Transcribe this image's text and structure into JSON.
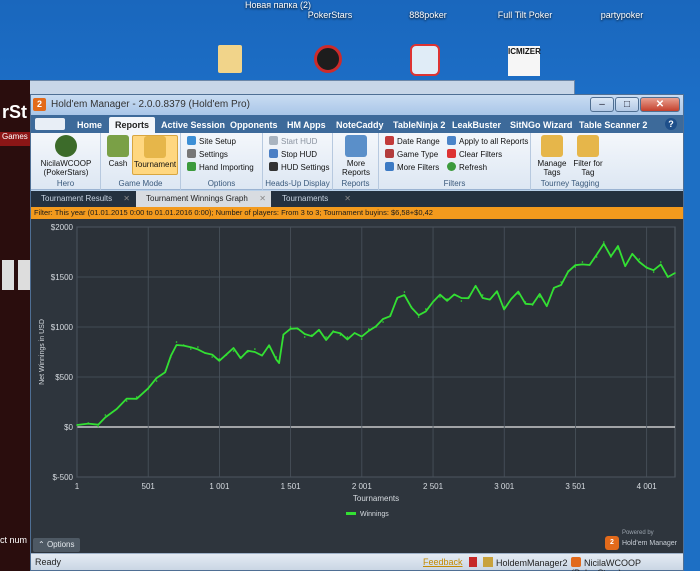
{
  "desktop": {
    "icons": [
      {
        "label": "Новая папка (2)",
        "icon": "folder-icon"
      },
      {
        "label": "PokerStars",
        "icon": "pokerstars-icon"
      },
      {
        "label": "888poker",
        "icon": "888poker-icon"
      },
      {
        "label": "Full Tilt Poker",
        "icon": "fulltilt-icon"
      },
      {
        "label": "partypoker",
        "icon": "partypoker-icon"
      }
    ],
    "icmizer_label": "ICMIZER"
  },
  "background_app": {
    "title_fragment": "rSt",
    "games_label": "Games",
    "text_fragment": "ct num"
  },
  "window": {
    "title": "Hold'em Manager - 2.0.0.8379 (Hold'em Pro)",
    "controls": {
      "minimize": "–",
      "maximize": "□",
      "close": "✕"
    }
  },
  "menu": {
    "tabs": [
      "Home",
      "Reports",
      "Active Session",
      "Opponents",
      "HM Apps",
      "NoteCaddy",
      "TableNinja 2",
      "LeakBuster",
      "SitNGo Wizard",
      "Table Scanner 2"
    ],
    "active": "Reports",
    "help": "?"
  },
  "ribbon": {
    "hero": {
      "player": "NicilaWCOOP (PokerStars)",
      "group": "Hero"
    },
    "game_mode": {
      "cash": "Cash",
      "tournament": "Tournament",
      "group": "Game Mode",
      "active": "Tournament"
    },
    "options": {
      "site_setup": "Site Setup",
      "settings": "Settings",
      "hand_importing": "Hand Importing",
      "group": "Options"
    },
    "hud": {
      "start": "Start HUD",
      "stop": "Stop HUD",
      "settings": "HUD Settings",
      "group": "Heads-Up Display"
    },
    "reports": {
      "more": "More Reports",
      "group": "Reports"
    },
    "filters": {
      "date_range": "Date Range",
      "game_type": "Game Type",
      "more_filters": "More Filters",
      "apply_all": "Apply to all Reports",
      "clear": "Clear Filters",
      "refresh": "Refresh",
      "group": "Filters"
    },
    "tagging": {
      "manage": "Manage Tags",
      "filter": "Filter for Tag",
      "group": "Tourney Tagging"
    }
  },
  "doc_tabs": [
    {
      "label": "Tournament Results",
      "active": false
    },
    {
      "label": "Tournament Winnings Graph",
      "active": true
    },
    {
      "label": "Tournaments",
      "active": false
    }
  ],
  "filter_text": "Filter: This year (01.01.2015 0:00 to 01.01.2016 0:00); Number of players: From 3 to 3; Tournament buyins: $6,58+$0,42",
  "chart_data": {
    "type": "line",
    "xlabel": "Tournaments",
    "ylabel": "Net Winnings in USD",
    "xlim": [
      1,
      4200
    ],
    "ylim": [
      -500,
      2000
    ],
    "x_ticks": [
      {
        "v": 1,
        "label": "1"
      },
      {
        "v": 501,
        "label": "501"
      },
      {
        "v": 1001,
        "label": "1 001"
      },
      {
        "v": 1501,
        "label": "1 501"
      },
      {
        "v": 2001,
        "label": "2 001"
      },
      {
        "v": 2501,
        "label": "2 501"
      },
      {
        "v": 3001,
        "label": "3 001"
      },
      {
        "v": 3501,
        "label": "3 501"
      },
      {
        "v": 4001,
        "label": "4 001"
      }
    ],
    "y_ticks": [
      {
        "v": -500,
        "label": "$-500"
      },
      {
        "v": 0,
        "label": "$0"
      },
      {
        "v": 500,
        "label": "$500"
      },
      {
        "v": 1000,
        "label": "$1000"
      },
      {
        "v": 1500,
        "label": "$1500"
      },
      {
        "v": 2000,
        "label": "$2000"
      }
    ],
    "grid": true,
    "legend": "bottom-center",
    "series": [
      {
        "name": "Winnings",
        "color": "#33e033",
        "x": [
          1,
          80,
          150,
          200,
          280,
          350,
          420,
          500,
          560,
          620,
          660,
          700,
          750,
          800,
          850,
          900,
          950,
          1000,
          1050,
          1100,
          1150,
          1200,
          1250,
          1300,
          1350,
          1400,
          1420,
          1450,
          1500,
          1550,
          1600,
          1650,
          1700,
          1750,
          1800,
          1850,
          1900,
          1950,
          2000,
          2050,
          2100,
          2150,
          2200,
          2250,
          2300,
          2350,
          2400,
          2450,
          2500,
          2550,
          2600,
          2650,
          2700,
          2750,
          2800,
          2850,
          2900,
          2950,
          3000,
          3050,
          3100,
          3150,
          3200,
          3250,
          3300,
          3350,
          3400,
          3450,
          3500,
          3550,
          3600,
          3650,
          3700,
          3750,
          3800,
          3850,
          3900,
          3950,
          4000,
          4050,
          4100,
          4150,
          4200
        ],
        "y": [
          20,
          40,
          5,
          120,
          180,
          260,
          300,
          380,
          460,
          560,
          700,
          850,
          820,
          780,
          800,
          740,
          700,
          680,
          720,
          760,
          700,
          750,
          780,
          720,
          800,
          700,
          640,
          900,
          1000,
          980,
          900,
          920,
          960,
          900,
          960,
          920,
          900,
          940,
          880,
          980,
          1000,
          1050,
          1120,
          1280,
          1350,
          1200,
          1100,
          1180,
          1250,
          1300,
          1280,
          1320,
          1260,
          1300,
          1400,
          1320,
          1280,
          1340,
          1200,
          1280,
          1330,
          1250,
          1220,
          1300,
          1220,
          1380,
          1450,
          1560,
          1600,
          1650,
          1620,
          1700,
          1850,
          1700,
          1780,
          1620,
          1720,
          1680,
          1600,
          1550,
          1650,
          1500,
          1540
        ]
      }
    ]
  },
  "options_label": "Options",
  "brand": {
    "powered_by": "Powered by",
    "name": "Hold'em Manager"
  },
  "statusbar": {
    "ready": "Ready",
    "feedback": "Feedback",
    "app": "HoldemManager2",
    "hero": "NicilaWCOOP (PokerStars)"
  }
}
